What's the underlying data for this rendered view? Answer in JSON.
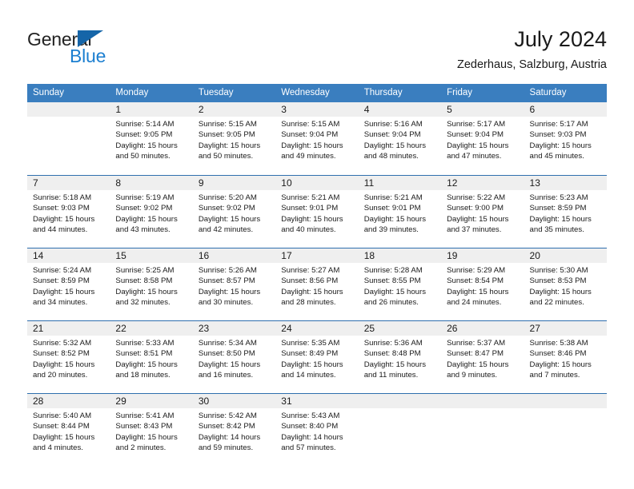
{
  "brand": {
    "name_part1": "General",
    "name_part2": "Blue",
    "logo_icon": "triangle-icon",
    "color_dark": "#222222",
    "color_blue": "#1c7fd0",
    "color_triangle": "#1565a8"
  },
  "header": {
    "title": "July 2024",
    "subtitle": "Zederhaus, Salzburg, Austria"
  },
  "theme": {
    "header_bg": "#3a7ebf",
    "header_text": "#ffffff",
    "week_divider": "#2f6fae",
    "day_number_bg": "#efefef",
    "body_text": "#1a1a1a"
  },
  "weekdays": [
    "Sunday",
    "Monday",
    "Tuesday",
    "Wednesday",
    "Thursday",
    "Friday",
    "Saturday"
  ],
  "calendar": {
    "month": "July",
    "year": 2024,
    "weeks": [
      [
        {
          "day": "",
          "empty": true,
          "lines": []
        },
        {
          "day": "1",
          "lines": [
            "Sunrise: 5:14 AM",
            "Sunset: 9:05 PM",
            "Daylight: 15 hours",
            "and 50 minutes."
          ]
        },
        {
          "day": "2",
          "lines": [
            "Sunrise: 5:15 AM",
            "Sunset: 9:05 PM",
            "Daylight: 15 hours",
            "and 50 minutes."
          ]
        },
        {
          "day": "3",
          "lines": [
            "Sunrise: 5:15 AM",
            "Sunset: 9:04 PM",
            "Daylight: 15 hours",
            "and 49 minutes."
          ]
        },
        {
          "day": "4",
          "lines": [
            "Sunrise: 5:16 AM",
            "Sunset: 9:04 PM",
            "Daylight: 15 hours",
            "and 48 minutes."
          ]
        },
        {
          "day": "5",
          "lines": [
            "Sunrise: 5:17 AM",
            "Sunset: 9:04 PM",
            "Daylight: 15 hours",
            "and 47 minutes."
          ]
        },
        {
          "day": "6",
          "lines": [
            "Sunrise: 5:17 AM",
            "Sunset: 9:03 PM",
            "Daylight: 15 hours",
            "and 45 minutes."
          ]
        }
      ],
      [
        {
          "day": "7",
          "lines": [
            "Sunrise: 5:18 AM",
            "Sunset: 9:03 PM",
            "Daylight: 15 hours",
            "and 44 minutes."
          ]
        },
        {
          "day": "8",
          "lines": [
            "Sunrise: 5:19 AM",
            "Sunset: 9:02 PM",
            "Daylight: 15 hours",
            "and 43 minutes."
          ]
        },
        {
          "day": "9",
          "lines": [
            "Sunrise: 5:20 AM",
            "Sunset: 9:02 PM",
            "Daylight: 15 hours",
            "and 42 minutes."
          ]
        },
        {
          "day": "10",
          "lines": [
            "Sunrise: 5:21 AM",
            "Sunset: 9:01 PM",
            "Daylight: 15 hours",
            "and 40 minutes."
          ]
        },
        {
          "day": "11",
          "lines": [
            "Sunrise: 5:21 AM",
            "Sunset: 9:01 PM",
            "Daylight: 15 hours",
            "and 39 minutes."
          ]
        },
        {
          "day": "12",
          "lines": [
            "Sunrise: 5:22 AM",
            "Sunset: 9:00 PM",
            "Daylight: 15 hours",
            "and 37 minutes."
          ]
        },
        {
          "day": "13",
          "lines": [
            "Sunrise: 5:23 AM",
            "Sunset: 8:59 PM",
            "Daylight: 15 hours",
            "and 35 minutes."
          ]
        }
      ],
      [
        {
          "day": "14",
          "lines": [
            "Sunrise: 5:24 AM",
            "Sunset: 8:59 PM",
            "Daylight: 15 hours",
            "and 34 minutes."
          ]
        },
        {
          "day": "15",
          "lines": [
            "Sunrise: 5:25 AM",
            "Sunset: 8:58 PM",
            "Daylight: 15 hours",
            "and 32 minutes."
          ]
        },
        {
          "day": "16",
          "lines": [
            "Sunrise: 5:26 AM",
            "Sunset: 8:57 PM",
            "Daylight: 15 hours",
            "and 30 minutes."
          ]
        },
        {
          "day": "17",
          "lines": [
            "Sunrise: 5:27 AM",
            "Sunset: 8:56 PM",
            "Daylight: 15 hours",
            "and 28 minutes."
          ]
        },
        {
          "day": "18",
          "lines": [
            "Sunrise: 5:28 AM",
            "Sunset: 8:55 PM",
            "Daylight: 15 hours",
            "and 26 minutes."
          ]
        },
        {
          "day": "19",
          "lines": [
            "Sunrise: 5:29 AM",
            "Sunset: 8:54 PM",
            "Daylight: 15 hours",
            "and 24 minutes."
          ]
        },
        {
          "day": "20",
          "lines": [
            "Sunrise: 5:30 AM",
            "Sunset: 8:53 PM",
            "Daylight: 15 hours",
            "and 22 minutes."
          ]
        }
      ],
      [
        {
          "day": "21",
          "lines": [
            "Sunrise: 5:32 AM",
            "Sunset: 8:52 PM",
            "Daylight: 15 hours",
            "and 20 minutes."
          ]
        },
        {
          "day": "22",
          "lines": [
            "Sunrise: 5:33 AM",
            "Sunset: 8:51 PM",
            "Daylight: 15 hours",
            "and 18 minutes."
          ]
        },
        {
          "day": "23",
          "lines": [
            "Sunrise: 5:34 AM",
            "Sunset: 8:50 PM",
            "Daylight: 15 hours",
            "and 16 minutes."
          ]
        },
        {
          "day": "24",
          "lines": [
            "Sunrise: 5:35 AM",
            "Sunset: 8:49 PM",
            "Daylight: 15 hours",
            "and 14 minutes."
          ]
        },
        {
          "day": "25",
          "lines": [
            "Sunrise: 5:36 AM",
            "Sunset: 8:48 PM",
            "Daylight: 15 hours",
            "and 11 minutes."
          ]
        },
        {
          "day": "26",
          "lines": [
            "Sunrise: 5:37 AM",
            "Sunset: 8:47 PM",
            "Daylight: 15 hours",
            "and 9 minutes."
          ]
        },
        {
          "day": "27",
          "lines": [
            "Sunrise: 5:38 AM",
            "Sunset: 8:46 PM",
            "Daylight: 15 hours",
            "and 7 minutes."
          ]
        }
      ],
      [
        {
          "day": "28",
          "lines": [
            "Sunrise: 5:40 AM",
            "Sunset: 8:44 PM",
            "Daylight: 15 hours",
            "and 4 minutes."
          ]
        },
        {
          "day": "29",
          "lines": [
            "Sunrise: 5:41 AM",
            "Sunset: 8:43 PM",
            "Daylight: 15 hours",
            "and 2 minutes."
          ]
        },
        {
          "day": "30",
          "lines": [
            "Sunrise: 5:42 AM",
            "Sunset: 8:42 PM",
            "Daylight: 14 hours",
            "and 59 minutes."
          ]
        },
        {
          "day": "31",
          "lines": [
            "Sunrise: 5:43 AM",
            "Sunset: 8:40 PM",
            "Daylight: 14 hours",
            "and 57 minutes."
          ]
        },
        {
          "day": "",
          "empty": true,
          "lines": []
        },
        {
          "day": "",
          "empty": true,
          "lines": []
        },
        {
          "day": "",
          "empty": true,
          "lines": []
        }
      ]
    ]
  }
}
